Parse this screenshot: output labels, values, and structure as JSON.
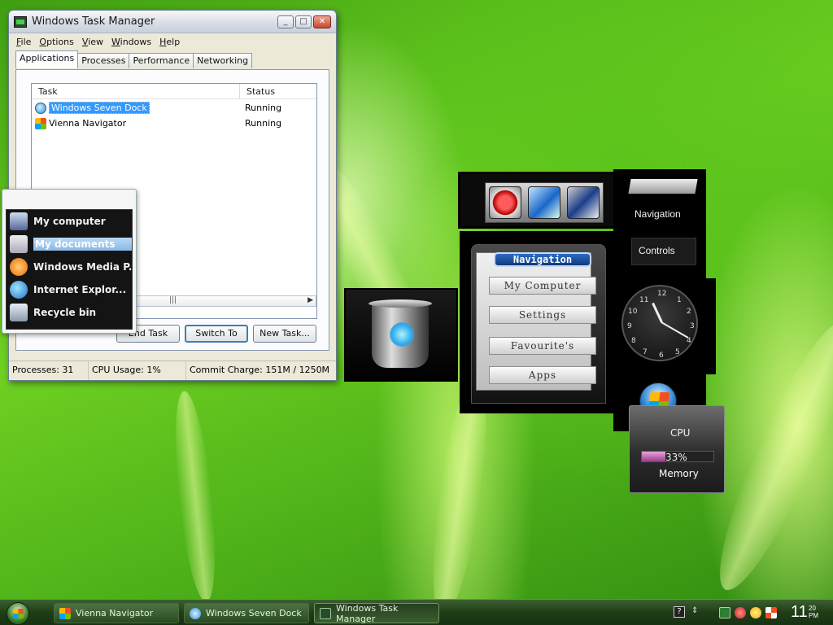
{
  "task_manager": {
    "title": "Windows Task Manager",
    "menu": [
      "File",
      "Options",
      "View",
      "Windows",
      "Help"
    ],
    "tabs": [
      "Applications",
      "Processes",
      "Performance",
      "Networking"
    ],
    "columns": {
      "task": "Task",
      "status": "Status"
    },
    "rows": [
      {
        "task": "Windows Seven Dock",
        "status": "Running"
      },
      {
        "task": "Vienna Navigator",
        "status": "Running"
      }
    ],
    "buttons": {
      "end_task": "End Task",
      "switch_to": "Switch To",
      "new_task": "New Task..."
    },
    "statusbar": {
      "processes": "Processes: 31",
      "cpu": "CPU Usage: 1%",
      "commit": "Commit Charge: 151M / 1250M"
    },
    "window_buttons": {
      "minimize": "_",
      "maximize": "□",
      "close": "✕"
    }
  },
  "dock": {
    "items": [
      {
        "label": "My computer",
        "icon": "computer-icon"
      },
      {
        "label": "My documents",
        "icon": "documents-icon"
      },
      {
        "label": "Windows Media P...",
        "icon": "media-player-icon"
      },
      {
        "label": "Internet Explor...",
        "icon": "internet-explorer-icon"
      },
      {
        "label": "Recycle bin",
        "icon": "recycle-bin-icon"
      }
    ]
  },
  "navigator": {
    "header": "Navigation",
    "buttons": [
      "My Computer",
      "Settings",
      "Favourite's",
      "Apps"
    ],
    "side_tabs": {
      "navigation": "Navigation",
      "controls": "Controls"
    }
  },
  "clock": {
    "numbers": [
      "12",
      "1",
      "2",
      "3",
      "4",
      "5",
      "6",
      "7",
      "8",
      "9",
      "10",
      "11"
    ]
  },
  "cpu_meter": {
    "cpu_label": "CPU",
    "memory_percent": "33%",
    "memory_fill": 0.33,
    "memory_label": "Memory"
  },
  "taskbar": {
    "buttons": [
      "Vienna Navigator",
      "Windows Seven Dock",
      "Windows Task Manager"
    ],
    "time": "11",
    "time_minutes": "20",
    "time_ampm": "PM"
  }
}
